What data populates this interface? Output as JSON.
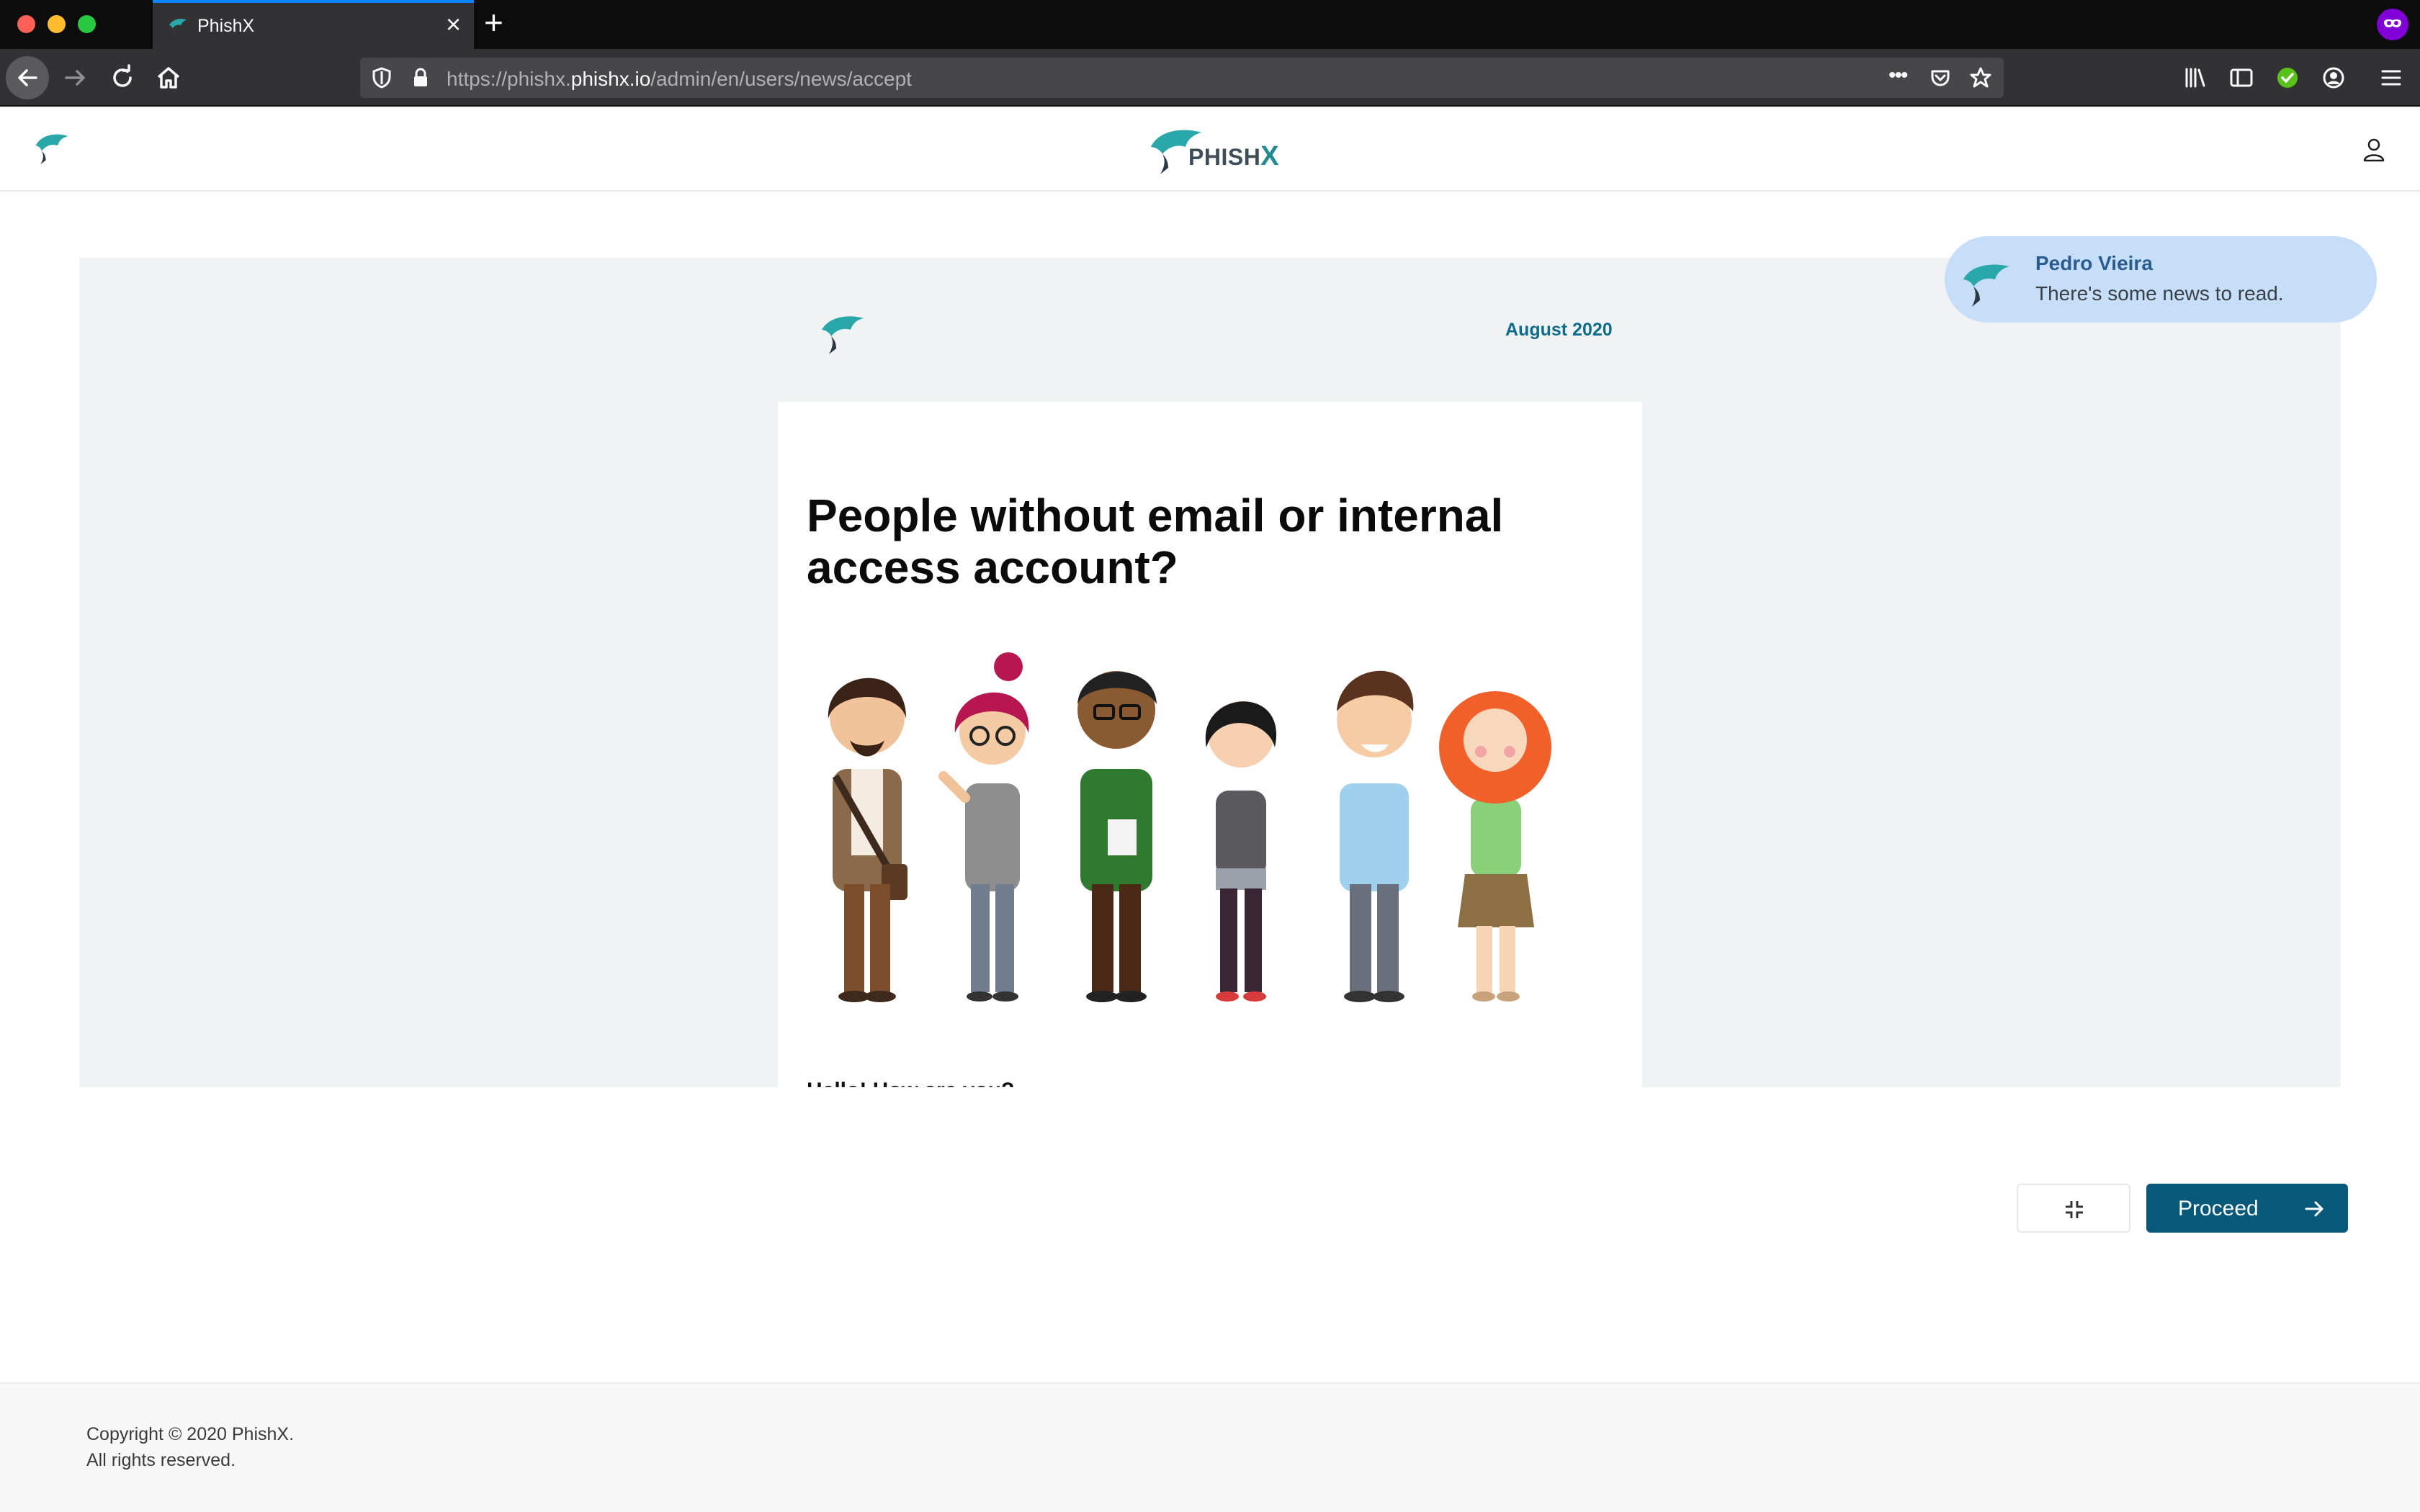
{
  "browser": {
    "tab_title": "PhishX",
    "url_prefix": "https://phishx.",
    "url_domain": "phishx.io",
    "url_path": "/admin/en/users/news/accept",
    "url_more": "•••"
  },
  "header": {
    "brand_name": "PHISH",
    "brand_x": "X"
  },
  "news": {
    "date": "August 2020",
    "title": "People without email or internal access account?",
    "cutoff_text": "Hello! How are you?"
  },
  "notification": {
    "sender": "Pedro Vieira",
    "message": "There's some news to read."
  },
  "actions": {
    "proceed_label": "Proceed"
  },
  "footer": {
    "copyright": "Copyright © 2020 PhishX.",
    "rights": "All rights reserved."
  },
  "colors": {
    "primary": "#08587a",
    "brand_teal": "#1f8a90",
    "date_blue": "#0d6d8a",
    "toast_bg": "#c6def7",
    "private_purple": "#8000d7"
  }
}
